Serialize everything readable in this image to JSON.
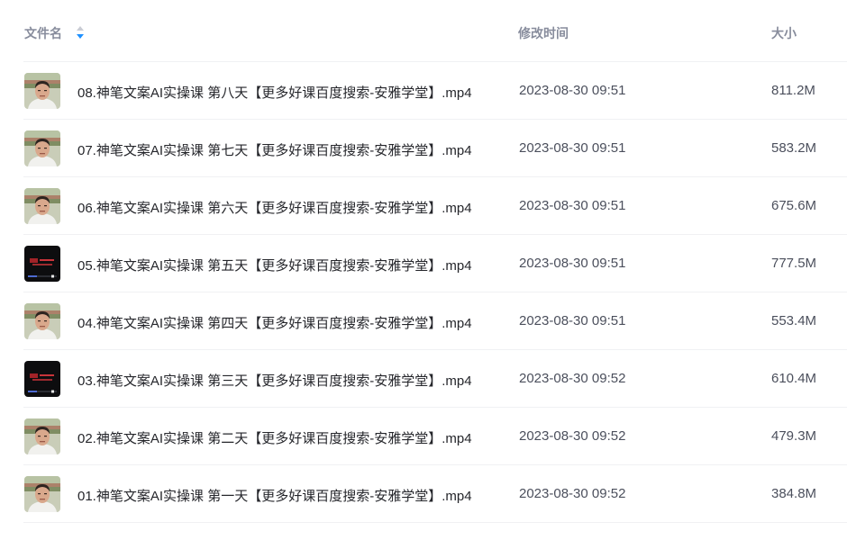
{
  "columns": {
    "name": "文件名",
    "modified": "修改时间",
    "size": "大小"
  },
  "sort": {
    "column": "name",
    "icon": "sort-icon",
    "accent": "#1e90ff"
  },
  "files": [
    {
      "name": "08.神笔文案AI实操课 第八天【更多好课百度搜索-安雅学堂】.mp4",
      "modified": "2023-08-30 09:51",
      "size": "811.2M",
      "thumbnail": "man-portrait"
    },
    {
      "name": "07.神笔文案AI实操课 第七天【更多好课百度搜索-安雅学堂】.mp4",
      "modified": "2023-08-30 09:51",
      "size": "583.2M",
      "thumbnail": "man-portrait"
    },
    {
      "name": "06.神笔文案AI实操课 第六天【更多好课百度搜索-安雅学堂】.mp4",
      "modified": "2023-08-30 09:51",
      "size": "675.6M",
      "thumbnail": "man-portrait"
    },
    {
      "name": "05.神笔文案AI实操课 第五天【更多好课百度搜索-安雅学堂】.mp4",
      "modified": "2023-08-30 09:51",
      "size": "777.5M",
      "thumbnail": "dark-slide"
    },
    {
      "name": "04.神笔文案AI实操课 第四天【更多好课百度搜索-安雅学堂】.mp4",
      "modified": "2023-08-30 09:51",
      "size": "553.4M",
      "thumbnail": "man-portrait"
    },
    {
      "name": "03.神笔文案AI实操课 第三天【更多好课百度搜索-安雅学堂】.mp4",
      "modified": "2023-08-30 09:52",
      "size": "610.4M",
      "thumbnail": "dark-slide"
    },
    {
      "name": "02.神笔文案AI实操课 第二天【更多好课百度搜索-安雅学堂】.mp4",
      "modified": "2023-08-30 09:52",
      "size": "479.3M",
      "thumbnail": "man-portrait"
    },
    {
      "name": "01.神笔文案AI实操课 第一天【更多好课百度搜索-安雅学堂】.mp4",
      "modified": "2023-08-30 09:52",
      "size": "384.8M",
      "thumbnail": "man-portrait"
    }
  ]
}
